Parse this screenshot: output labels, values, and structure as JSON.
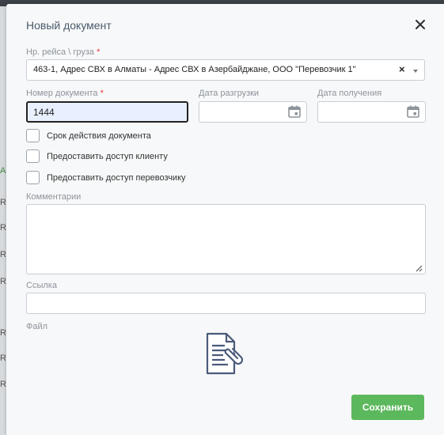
{
  "modal": {
    "title": "Новый документ"
  },
  "backdrop": {
    "left_letters": [
      "A",
      "R",
      "R",
      "R",
      "R",
      "R",
      "R",
      "R"
    ]
  },
  "form": {
    "shipment": {
      "label": "Нр. рейса \\ груза",
      "required_mark": "*",
      "value": "463-1, Адрес СВХ в Алматы - Адрес СВХ в Азербайджане, ООО \"Перевозчик 1\"",
      "clear_glyph": "×"
    },
    "doc_number": {
      "label": "Номер документа",
      "required_mark": "*",
      "value": "1444"
    },
    "unload_date": {
      "label": "Дата разгрузки",
      "value": ""
    },
    "receive_date": {
      "label": "Дата получения",
      "value": ""
    },
    "checkboxes": [
      {
        "label": "Срок действия документа",
        "checked": false
      },
      {
        "label": "Предоставить доступ клиенту",
        "checked": false
      },
      {
        "label": "Предоставить доступ перевозчику",
        "checked": false
      }
    ],
    "comments": {
      "label": "Комментарии",
      "value": ""
    },
    "link": {
      "label": "Ссылка",
      "value": ""
    },
    "file": {
      "label": "Файл",
      "icon": "document-attach-icon"
    },
    "save_label": "Сохранить"
  },
  "colors": {
    "accent": "#5cb85c",
    "required": "#e53935",
    "icon": "#4a5a7a"
  }
}
